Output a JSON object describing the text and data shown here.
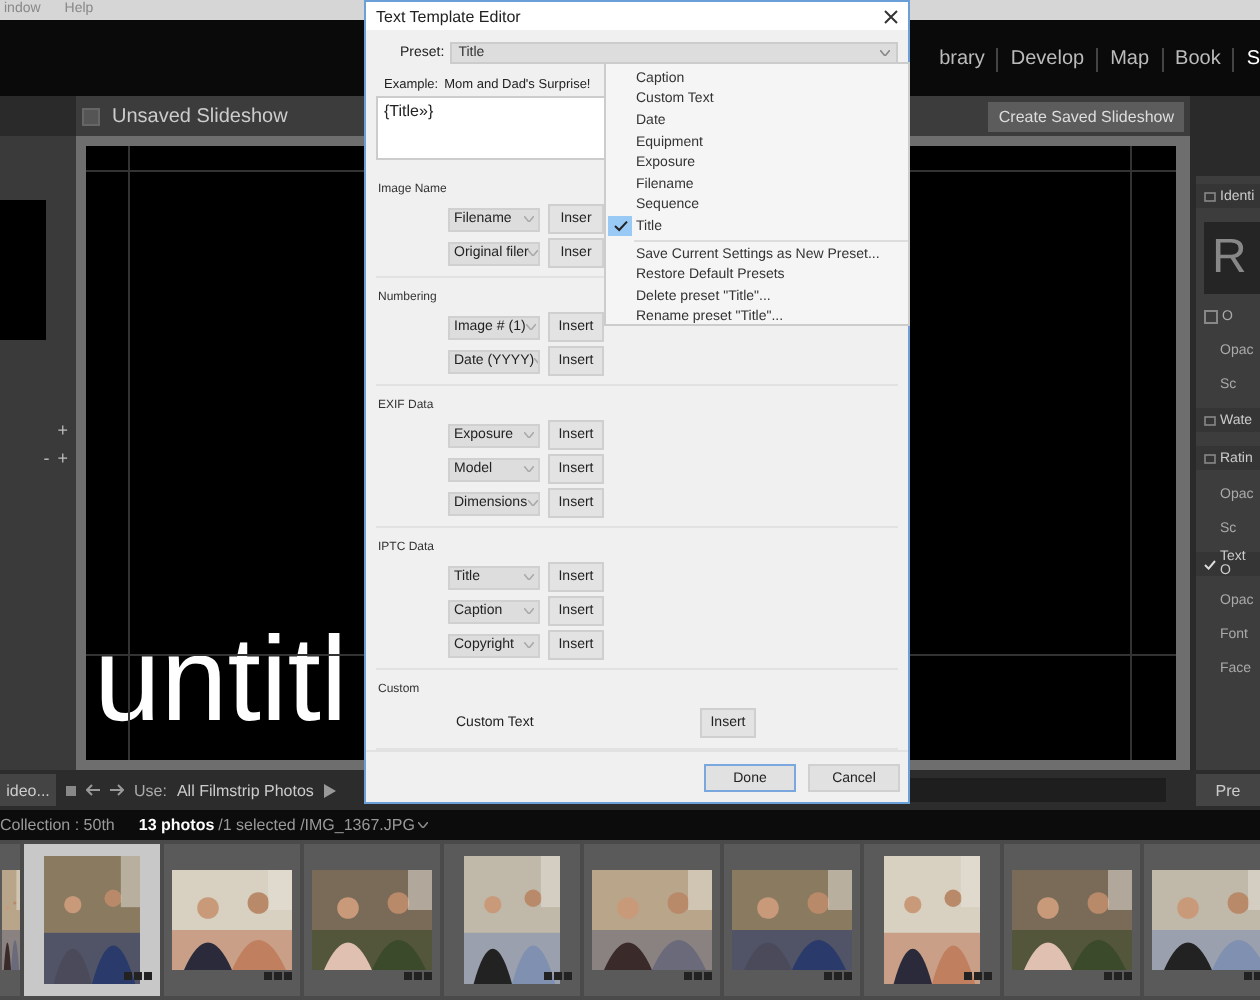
{
  "menu_bar": [
    "indow",
    "Help"
  ],
  "modules": [
    {
      "label": "brary",
      "selected": false
    },
    {
      "label": "Develop",
      "selected": false
    },
    {
      "label": "Map",
      "selected": false
    },
    {
      "label": "Book",
      "selected": false
    },
    {
      "label": "S",
      "selected": true
    }
  ],
  "left_panel": {
    "buttons": [
      "+",
      "-",
      "+"
    ]
  },
  "stage": {
    "title": "Unsaved Slideshow",
    "action": "Create Saved Slideshow",
    "overlay_text": "untitl"
  },
  "right_panel": [
    {
      "kind": "header",
      "label": "Identi",
      "checked": false
    },
    {
      "kind": "logo",
      "label": "R"
    },
    {
      "kind": "checkbox",
      "label": "O",
      "checked": false
    },
    {
      "kind": "row",
      "label": "Opac"
    },
    {
      "kind": "row",
      "label": "Sc"
    },
    {
      "kind": "header",
      "label": "Wate",
      "checked": false
    },
    {
      "kind": "header",
      "label": "Ratin",
      "checked": false
    },
    {
      "kind": "row",
      "label": "Opac"
    },
    {
      "kind": "row",
      "label": "Sc"
    },
    {
      "kind": "header",
      "label": "Text O",
      "checked": true
    },
    {
      "kind": "row",
      "label": "Opac"
    },
    {
      "kind": "row",
      "label": "Font"
    },
    {
      "kind": "row",
      "label": "Face"
    }
  ],
  "toolbar": {
    "left_button": "ideo...",
    "use_label": "Use:",
    "use_value": "All Filmstrip Photos",
    "right_button": "Pre"
  },
  "info": {
    "collection": "Collection : 50th",
    "count": "13 photos",
    "selection": "/1 selected /IMG_1367.JPG"
  },
  "filmstrip": [
    {
      "kind": "picture",
      "selected": false
    },
    {
      "kind": "picture",
      "selected": true
    },
    {
      "kind": "picture",
      "selected": false
    },
    {
      "kind": "picture",
      "selected": false
    },
    {
      "kind": "picture",
      "selected": false
    },
    {
      "kind": "picture",
      "selected": false
    },
    {
      "kind": "picture",
      "selected": false
    },
    {
      "kind": "picture",
      "selected": false
    },
    {
      "kind": "picture",
      "selected": false
    },
    {
      "kind": "picture",
      "selected": false
    }
  ],
  "dialog": {
    "title": "Text Template Editor",
    "preset_label": "Preset:",
    "preset_value": "Title",
    "example_label": "Example:",
    "example_value": "Mom and Dad's Surprise!",
    "template": "{Title»}",
    "sections": [
      {
        "label": "Image Name",
        "rows": [
          {
            "token": "Filename",
            "button": "Inser"
          },
          {
            "token": "Original filer",
            "button": "Inser"
          }
        ]
      },
      {
        "label": "Numbering",
        "rows": [
          {
            "token": "Image # (1)",
            "button": "Insert"
          },
          {
            "token": "Date (YYYY)",
            "button": "Insert"
          }
        ]
      },
      {
        "label": "EXIF Data",
        "rows": [
          {
            "token": "Exposure",
            "button": "Insert"
          },
          {
            "token": "Model",
            "button": "Insert"
          },
          {
            "token": "Dimensions",
            "button": "Insert"
          }
        ]
      },
      {
        "label": "IPTC Data",
        "rows": [
          {
            "token": "Title",
            "button": "Insert"
          },
          {
            "token": "Caption",
            "button": "Insert"
          },
          {
            "token": "Copyright",
            "button": "Insert"
          }
        ]
      }
    ],
    "custom": {
      "label": "Custom",
      "field_label": "Custom Text",
      "button": "Insert"
    },
    "buttons": [
      {
        "label": "Done",
        "default": true
      },
      {
        "label": "Cancel",
        "default": false
      }
    ]
  },
  "preset_menu": [
    {
      "kind": "preset",
      "label": "Caption",
      "checked": false
    },
    {
      "kind": "preset",
      "label": "Custom Text",
      "checked": false
    },
    {
      "kind": "preset",
      "label": "Date",
      "checked": false
    },
    {
      "kind": "preset",
      "label": "Equipment",
      "checked": false
    },
    {
      "kind": "preset",
      "label": "Exposure",
      "checked": false
    },
    {
      "kind": "preset",
      "label": "Filename",
      "checked": false
    },
    {
      "kind": "preset",
      "label": "Sequence",
      "checked": false
    },
    {
      "kind": "preset",
      "label": "Title",
      "checked": true
    },
    {
      "kind": "action",
      "label": "Save Current Settings as New Preset..."
    },
    {
      "kind": "action",
      "label": "Restore Default Presets"
    },
    {
      "kind": "action",
      "label": "Delete preset \"Title\"..."
    },
    {
      "kind": "action",
      "label": "Rename preset \"Title\"..."
    }
  ]
}
